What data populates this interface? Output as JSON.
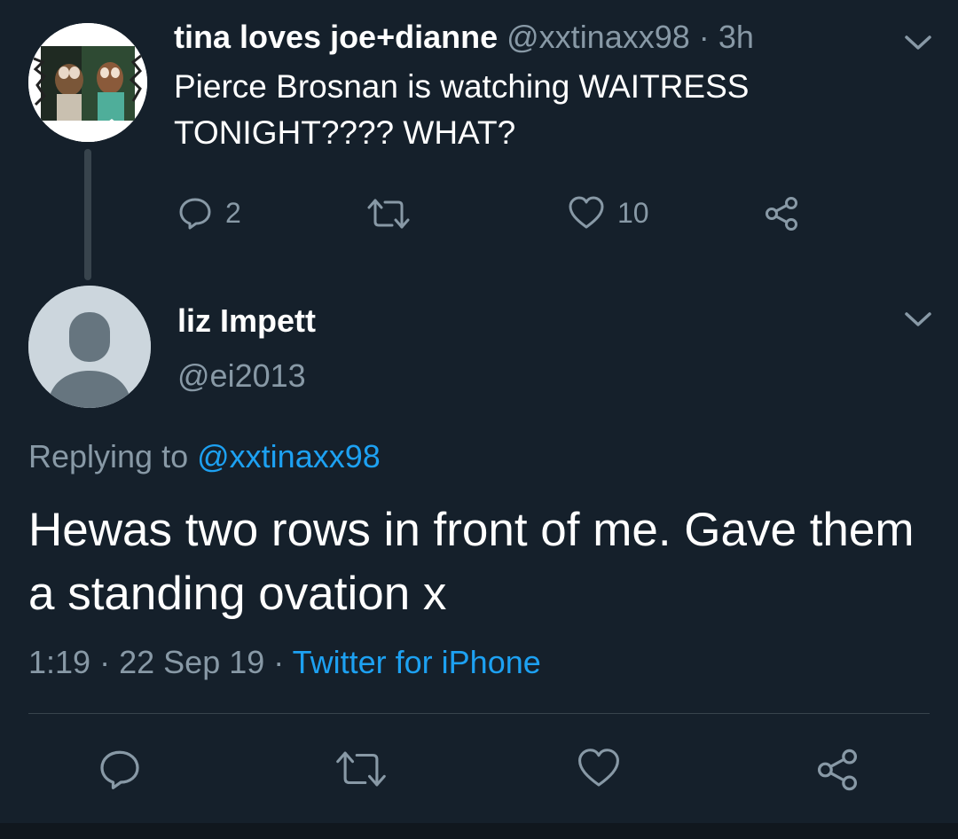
{
  "parent_tweet": {
    "display_name": "tina loves joe+dianne",
    "handle": "@xxtinaxx98",
    "separator": "·",
    "time": "3h",
    "text": "Pierce Brosnan is watching WAITRESS TONIGHT???? WHAT?",
    "reply_count": "2",
    "retweet_count": "",
    "like_count": "10",
    "avatar_icon": "cartoon-rats-avatar",
    "menu_icon": "chevron-down-icon"
  },
  "reply_tweet": {
    "display_name": "liz Impett",
    "handle": "@ei2013",
    "replying_prefix": "Replying to",
    "replying_handle": "@xxtinaxx98",
    "text": "Hewas two rows in front of me. Gave them a standing ovation x",
    "time": "1:19",
    "date": "22 Sep 19",
    "separator": "·",
    "source": "Twitter for iPhone",
    "avatar_icon": "default-profile-avatar",
    "menu_icon": "chevron-down-icon"
  },
  "theme": {
    "background": "#15202b",
    "text_primary": "#ffffff",
    "text_secondary": "#8899a6",
    "link": "#1da1f2",
    "border": "#38444d"
  }
}
